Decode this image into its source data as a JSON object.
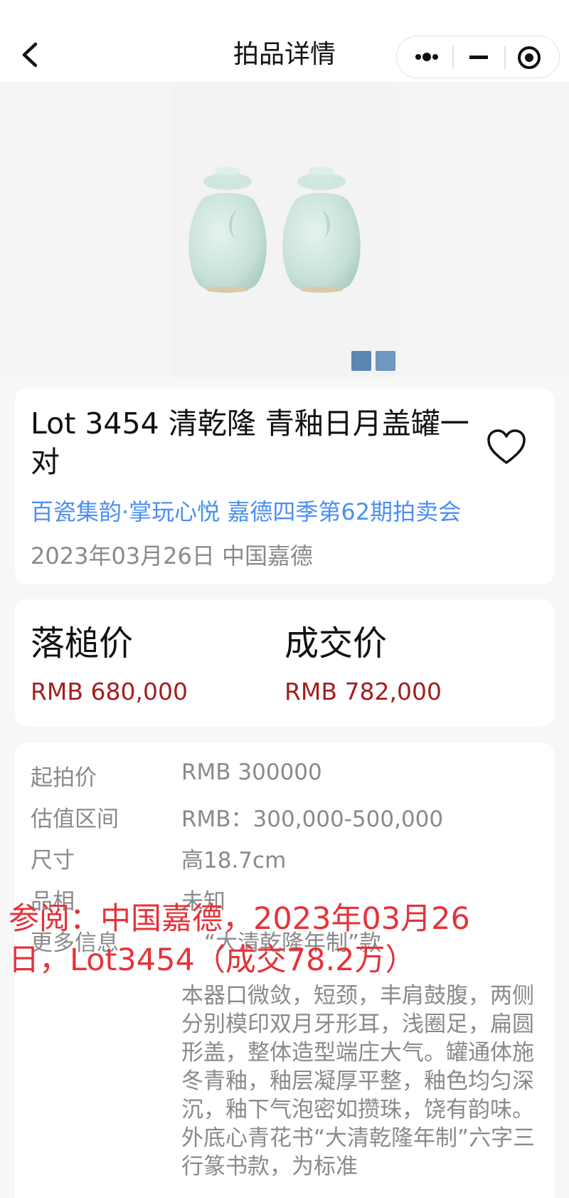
{
  "header": {
    "title": "拍品详情"
  },
  "capsule": {
    "more_icon": "more-dots-icon",
    "minimize_icon": "minimize-icon",
    "close_icon": "target-circle-icon"
  },
  "lot": {
    "title": "Lot 3454 清乾隆 青釉日月盖罐一对",
    "auction": "百瓷集韵·掌玩心悦 嘉德四季第62期拍卖会",
    "date_location": "2023年03月26日 中国嘉德",
    "favorite_icon": "heart-outline-icon"
  },
  "prices": {
    "hammer_label": "落槌价",
    "hammer_value": "RMB 680,000",
    "deal_label": "成交价",
    "deal_value": "RMB 782,000"
  },
  "details": {
    "rows": [
      {
        "label": "起拍价",
        "value": "RMB 300000"
      },
      {
        "label": "估值区间",
        "value": "RMB：300,000-500,000"
      },
      {
        "label": "尺寸",
        "value": "高18.7cm"
      },
      {
        "label": "品相",
        "value": "未知"
      },
      {
        "label": "更多信息",
        "value": "“大清乾隆年制”款"
      }
    ],
    "description": "本器口微敛，短颈，丰肩鼓腹，两侧分别模印双月牙形耳，浅圈足，扁圆形盖，整体造型端庄大气。罐通体施冬青釉，釉层凝厚平整，釉色均匀深沉，釉下气泡密如攒珠，饶有韵味。外底心青花书“大清乾隆年制”六字三行篆书款，为标准"
  },
  "watermark": "参阅：中国嘉德，2023年03月26日，Lot3454（成交78.2万）",
  "colors": {
    "price_red": "#a51e1e",
    "link_blue": "#4b8ff3",
    "watermark_red": "#e5333a",
    "celadon": "#cfe6df"
  }
}
